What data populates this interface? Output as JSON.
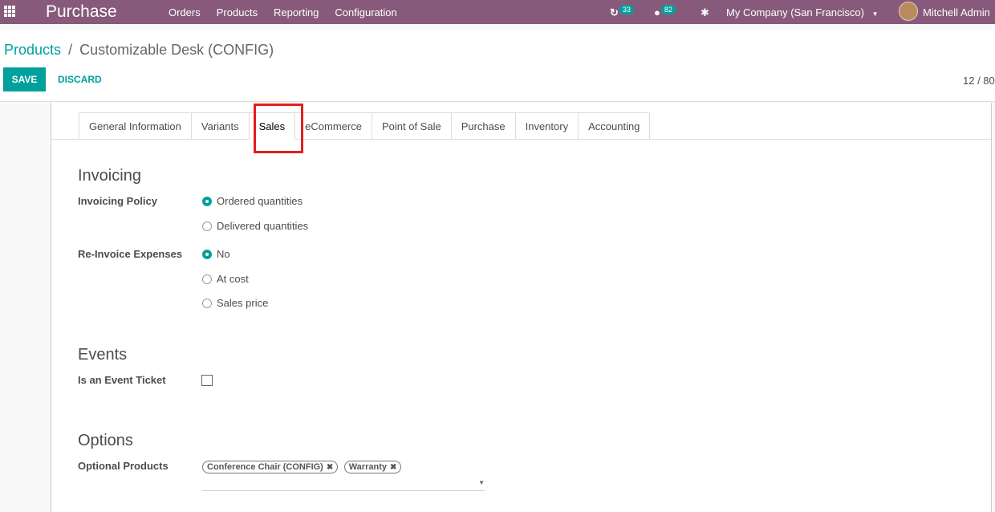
{
  "navbar": {
    "app_title": "Purchase",
    "menu": [
      "Orders",
      "Products",
      "Reporting",
      "Configuration"
    ],
    "activity_count": "33",
    "message_count": "82",
    "company": "My Company (San Francisco)",
    "user": "Mitchell Admin"
  },
  "breadcrumb": {
    "parent": "Products",
    "separator": "/",
    "current": "Customizable Desk (CONFIG)"
  },
  "buttons": {
    "save": "SAVE",
    "discard": "DISCARD"
  },
  "pager": "12 / 80",
  "tabs": [
    "General Information",
    "Variants",
    "Sales",
    "eCommerce",
    "Point of Sale",
    "Purchase",
    "Inventory",
    "Accounting"
  ],
  "active_tab": "Sales",
  "invoicing": {
    "title": "Invoicing",
    "policy_label": "Invoicing Policy",
    "policy_options": [
      "Ordered quantities",
      "Delivered quantities"
    ],
    "reinvoice_label": "Re-Invoice Expenses",
    "reinvoice_options": [
      "No",
      "At cost",
      "Sales price"
    ]
  },
  "events": {
    "title": "Events",
    "ticket_label": "Is an Event Ticket"
  },
  "options": {
    "title": "Options",
    "optional_label": "Optional Products",
    "tags": [
      "Conference Chair (CONFIG)",
      "Warranty"
    ]
  },
  "colors": {
    "navbar": "#875a7b",
    "accent": "#00a09d",
    "highlight": "#e0201d"
  }
}
